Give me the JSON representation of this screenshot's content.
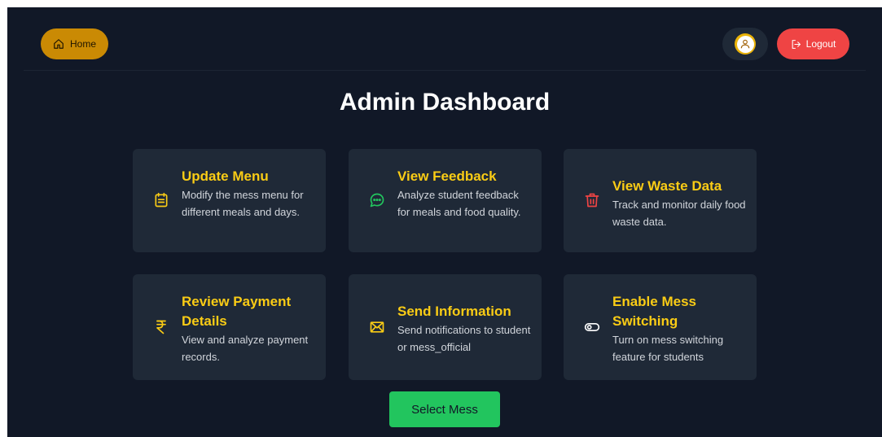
{
  "header": {
    "home_label": "Home",
    "logout_label": "Logout"
  },
  "page": {
    "title": "Admin Dashboard"
  },
  "cards": [
    {
      "title": "Update Menu",
      "description": "Modify the mess menu for different meals and days.",
      "icon": "clipboard-icon",
      "color": "#facc15"
    },
    {
      "title": "View Feedback",
      "description": "Analyze student feedback for meals and food quality.",
      "icon": "chat-icon",
      "color": "#22c55e"
    },
    {
      "title": "View Waste Data",
      "description": "Track and monitor daily food waste data.",
      "icon": "trash-icon",
      "color": "#ef4444"
    },
    {
      "title": "Review Payment Details",
      "description": "View and analyze payment records.",
      "icon": "rupee-icon",
      "color": "#facc15"
    },
    {
      "title": "Send Information",
      "description": "Send notifications to student or mess_official",
      "icon": "mail-icon",
      "color": "#facc15"
    },
    {
      "title": "Enable Mess Switching",
      "description": "Turn on mess switching feature for students",
      "icon": "toggle-icon",
      "color": "#ffffff"
    }
  ],
  "actions": {
    "select_mess_label": "Select Mess"
  },
  "colors": {
    "background": "#111827",
    "card": "#1f2937",
    "accent": "#facc15",
    "home": "#ca8a04",
    "logout": "#ef4444",
    "select": "#22c55e"
  }
}
